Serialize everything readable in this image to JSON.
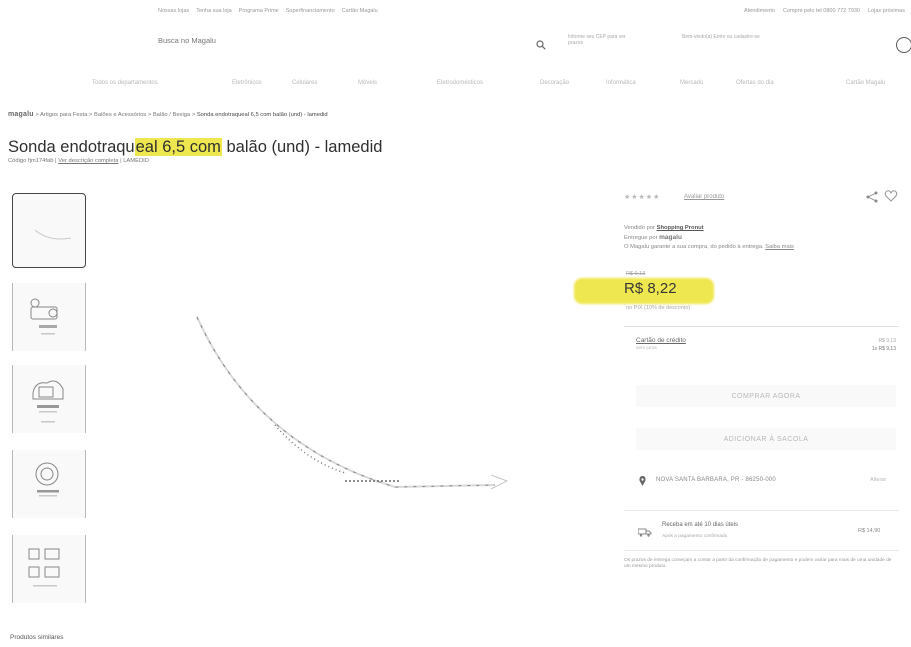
{
  "topbar": {
    "left_links": [
      "Nossas lojas",
      "Tenha sua loja",
      "Programa Prime",
      "Superfinanciamento",
      "Cartão Magalu"
    ],
    "right_links": [
      "Atendimento",
      "Compre pelo tel 0800 772 7930",
      "Lojas próximas"
    ]
  },
  "header": {
    "search_placeholder": "Busca no Magalu",
    "cep_text": "Informe seu CEP para ver prazos",
    "account_text": "Bem-vindo(a) Entre ou cadastre-se"
  },
  "catnav": {
    "items": [
      "Todos os departamentos",
      "Eletrônicos",
      "Celulares",
      "Móveis",
      "Eletrodomésticos",
      "Decoração",
      "Informática",
      "Mercado",
      "Ofertas do dia",
      "Cartão Magalu"
    ]
  },
  "breadcrumb": {
    "brand": "magalu",
    "path": [
      "Artigos para Festa",
      "Balões e Acessórios",
      "Balão / Bexiga"
    ],
    "current": "Sonda endotraqueal 6,5 com balão (und) - lamedid"
  },
  "product": {
    "title_before": "Sonda endotraqu",
    "title_highlight": "eal 6,5 com",
    "title_after": " balão (und) - lamedid",
    "code_prefix": "Código fjm174fab |",
    "code_link": "Ver descrição completa",
    "code_suffix": "| LAMEDID",
    "rating_stars": "★★★★★",
    "rate_link": "Avaliar produto",
    "sold_by_label": "Vendido por",
    "sold_by": "Shopping Pronut",
    "delivered_by_label": "Entregue por",
    "delivered_by": "magalu",
    "guarantee": "O Magalu garante a sua compra, do pedido à entrega.",
    "guarantee_link": "Saiba mais",
    "old_price": "R$ 9,13",
    "price": "R$ 8,22",
    "pix_text": "no PIX (10% de desconto)",
    "card_label": "Cartão de crédito",
    "card_sub": "sem juros",
    "card_value1": "R$ 9,13",
    "card_value2": "1x R$ 9,13",
    "buy_label": "COMPRAR AGORA",
    "bag_label": "ADICIONAR À SACOLA",
    "location": "NOVA SANTA BARBARA, PR - 86250-000",
    "change_label": "Alterar",
    "delivery": "Receba em até 10 dias úteis",
    "delivery_sub": "Após a pagamento confirmado",
    "delivery_price": "R$ 14,90",
    "notice": "Os prazos de entrega começam a contar a partir da confirmação de pagamento e podem variar para mais de uma unidade de um mesmo produto."
  },
  "similar_title": "Produtos similares",
  "colors": {
    "highlight": "#f7ee32",
    "text": "#2b2b2b",
    "muted": "#999999"
  }
}
